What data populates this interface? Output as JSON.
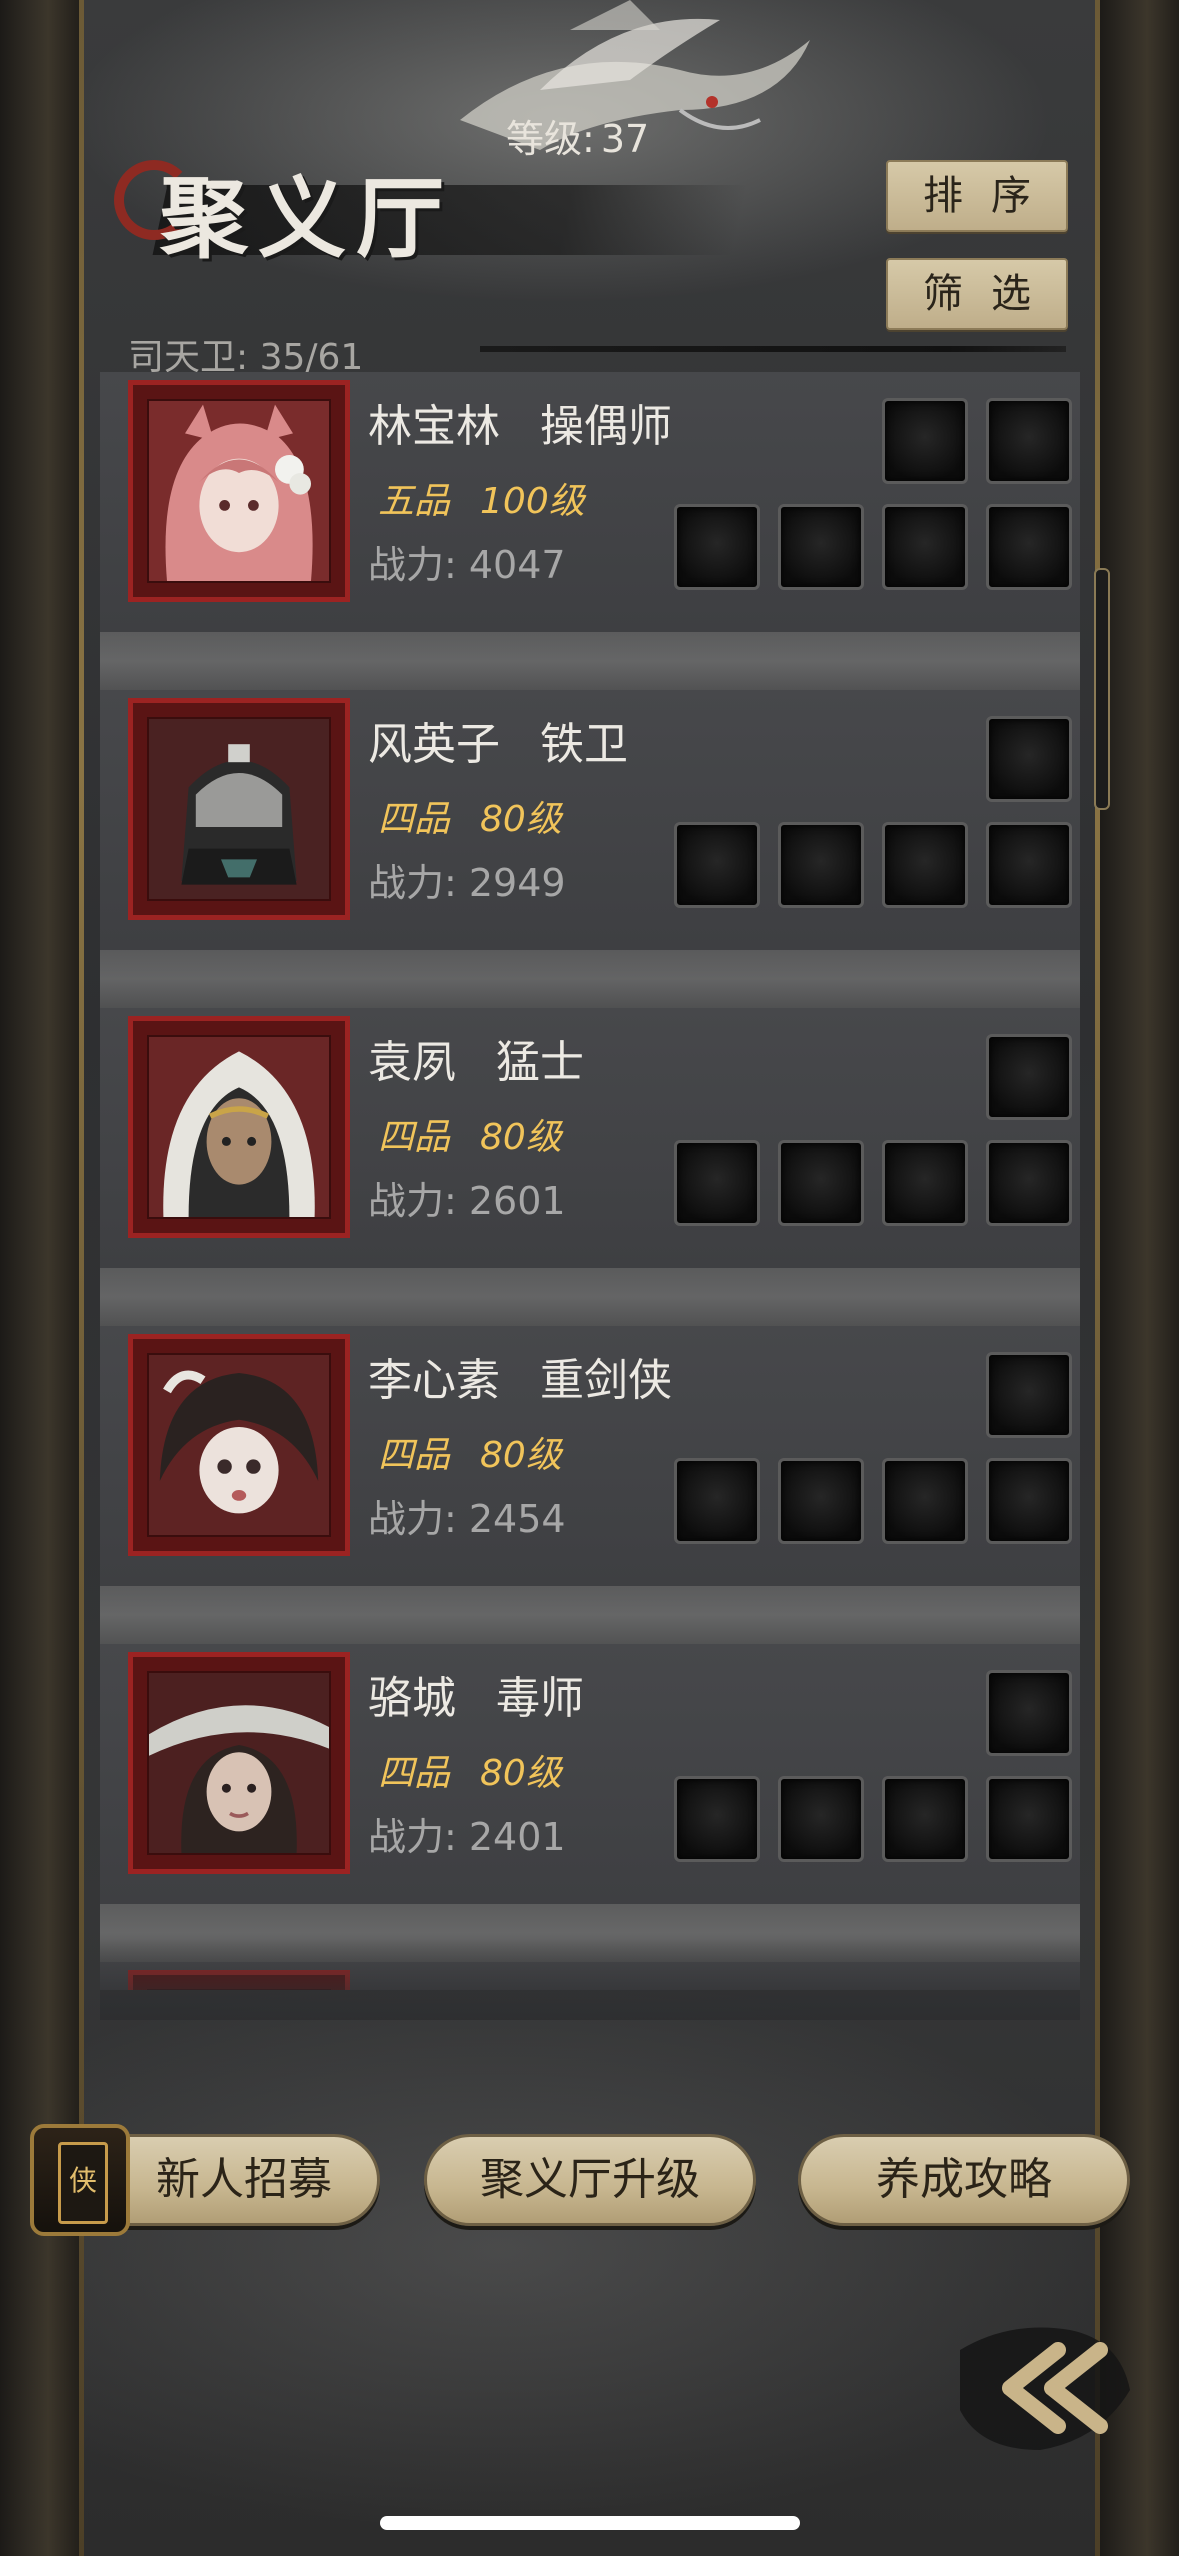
{
  "header": {
    "title": "聚义厅",
    "level_label": "等级:",
    "level_value": "37",
    "sort_label": "排序",
    "filter_label": "筛选",
    "guards_label": "司天卫: 35/61"
  },
  "heroes": [
    {
      "name": "林宝林",
      "class": "操偶师",
      "rank": "五品",
      "level": "100级",
      "power": "战力: 4047",
      "portrait": "pink-haired-girl-portrait"
    },
    {
      "name": "风英子",
      "class": "铁卫",
      "rank": "四品",
      "level": "80级",
      "power": "战力: 2949",
      "portrait": "armored-helmet-portrait"
    },
    {
      "name": "袁夙",
      "class": "猛士",
      "rank": "四品",
      "level": "80级",
      "power": "战力: 2601",
      "portrait": "hooded-warrior-portrait"
    },
    {
      "name": "李心素",
      "class": "重剑侠",
      "rank": "四品",
      "level": "80级",
      "power": "战力: 2454",
      "portrait": "dark-haired-girl-portrait"
    },
    {
      "name": "骆城",
      "class": "毒师",
      "rank": "四品",
      "level": "80级",
      "power": "战力: 2401",
      "portrait": "straw-hat-woman-portrait"
    }
  ],
  "bottom": {
    "recruit_label": "新人招募",
    "recruit_emblem": "侠",
    "upgrade_label": "聚义厅升级",
    "guide_label": "养成攻略"
  },
  "colors": {
    "rank_gold": "#f1c45a",
    "portrait_frame": "#9c2322",
    "button_beige": "#d6c9a8"
  }
}
